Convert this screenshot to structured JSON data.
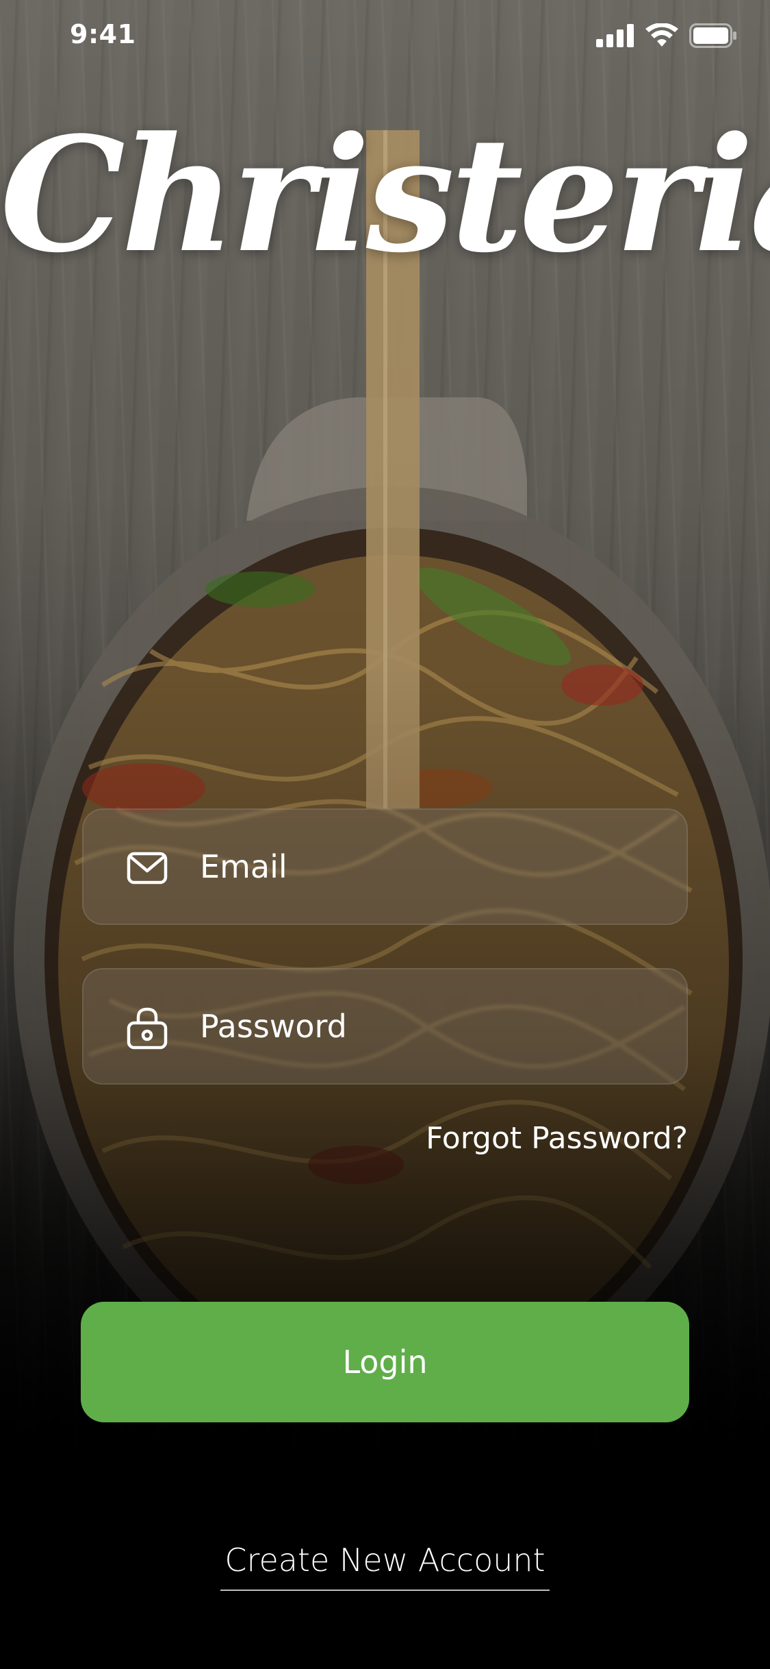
{
  "status_bar": {
    "time": "9:41",
    "icons": [
      "cellular-signal-icon",
      "wifi-icon",
      "battery-icon"
    ]
  },
  "app": {
    "logo_text": "Christeria",
    "accent_color": "#5fae4a"
  },
  "form": {
    "email": {
      "placeholder": "Email",
      "value": "",
      "icon": "mail-icon"
    },
    "password": {
      "placeholder": "Password",
      "value": "",
      "icon": "lock-icon"
    },
    "forgot_label": "Forgot Password?",
    "login_label": "Login",
    "create_account_label": "Create New Account"
  }
}
